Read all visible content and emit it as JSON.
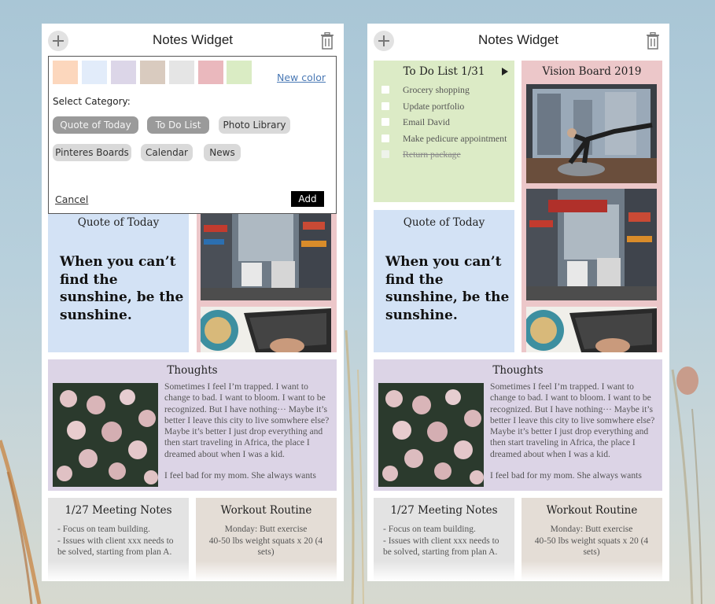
{
  "app": {
    "title": "Notes Widget"
  },
  "colors": {
    "quote_bg": "#d3e2f5",
    "pink_bg": "#ecc7c9",
    "todo_bg": "#dcebc6",
    "thoughts_bg": "#dcd4e6",
    "meeting_bg": "#e3e3e3",
    "workout_bg": "#e4ddd6"
  },
  "modal": {
    "swatches": [
      "#fcd7bd",
      "#e2ecfa",
      "#dcd6e8",
      "#d9cbbf",
      "#e5e5e5",
      "#eab8bd",
      "#daecc4"
    ],
    "new_color_label": "New color",
    "select_category_label": "Select Category:",
    "categories": [
      {
        "label": "Quote of Today",
        "selected": true
      },
      {
        "label": "To Do List",
        "selected": true
      },
      {
        "label": "Photo Library",
        "selected": false
      },
      {
        "label": "Pinteres Boards",
        "selected": false
      },
      {
        "label": "Calendar",
        "selected": false
      },
      {
        "label": "News",
        "selected": false
      }
    ],
    "cancel_label": "Cancel",
    "add_label": "Add"
  },
  "todo": {
    "title": "To Do List 1/31",
    "items": [
      {
        "text": "Grocery shopping",
        "done": false
      },
      {
        "text": "Update portfolio",
        "done": false
      },
      {
        "text": "Email David",
        "done": false
      },
      {
        "text": "Make pedicure appointment",
        "done": false
      },
      {
        "text": "Return package",
        "done": true
      }
    ]
  },
  "vision": {
    "title": "Vision Board 2019"
  },
  "quote": {
    "title": "Quote of Today",
    "text": "When you can’t find the sunshine, be the sunshine."
  },
  "thoughts": {
    "title": "Thoughts",
    "paragraph1": "Sometimes I feel I’m trapped. I want to change to bad. I want to bloom. I want to be recognized. But I have nothing··· Maybe it’s better I leave this city to live somwhere else? Maybe it’s better I just drop everything and then start traveling in Africa, the place I dreamed about when I was a kid.",
    "paragraph2": "I feel bad for my mom. She always wants"
  },
  "meeting": {
    "title": "1/27 Meeting Notes",
    "lines": [
      "- Focus on team building.",
      "- Issues with client xxx needs to",
      "be solved, starting from plan A."
    ]
  },
  "workout": {
    "title": "Workout Routine",
    "lines": [
      "Monday: Butt exercise",
      "40-50 lbs weight squats x 20 (4",
      "sets)"
    ]
  }
}
